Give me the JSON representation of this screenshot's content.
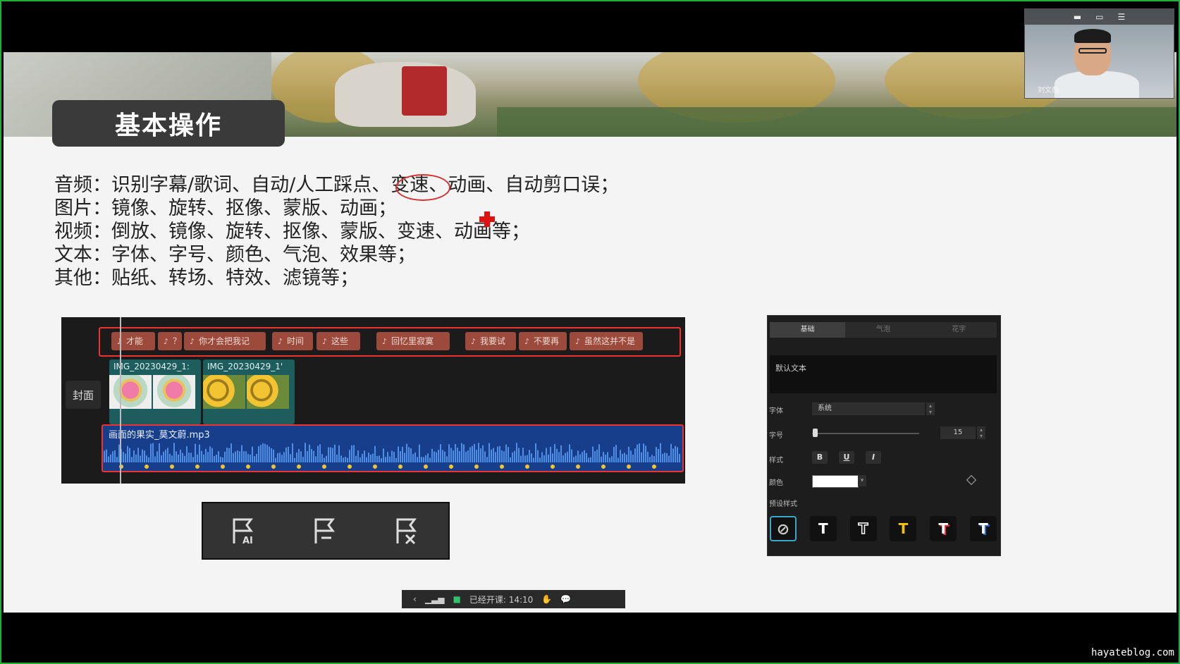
{
  "slide": {
    "title": "基本操作",
    "lines": [
      "音频：识别字幕/歌词、自动/人工踩点、变速、动画、自动剪口误；",
      "图片：镜像、旋转、抠像、蒙版、动画；",
      "视频：倒放、镜像、旋转、抠像、蒙版、变速、动画等；",
      "文本：字体、字号、颜色、气泡、效果等；",
      "其他：贴纸、转场、特效、滤镜等；"
    ]
  },
  "timeline": {
    "cover_label": "封面",
    "subtitle_clips": [
      "才能",
      "？",
      "你才会把我记",
      "时间",
      "这些",
      "回忆里寂寞",
      "我要试",
      "不要再",
      "虽然这并不是"
    ],
    "subtitle_icon": "tiktok-note-icon",
    "video_clips": [
      "IMG_20230429_1:",
      "IMG_20230429_1'"
    ],
    "audio_label": "画面的果实_莫文蔚.mp3"
  },
  "beat_toolbar": {
    "icons": [
      "auto-beat-icon",
      "manual-beat-icon",
      "clear-beat-icon"
    ]
  },
  "text_panel": {
    "tabs": [
      "基础",
      "气泡",
      "花字"
    ],
    "default_text": "默认文本",
    "font_label": "字体",
    "font_value": "系统",
    "size_label": "字号",
    "size_value": "15",
    "style_label": "样式",
    "style_buttons": [
      "B",
      "U",
      "I"
    ],
    "color_label": "颜色",
    "color_value": "#ffffff",
    "preset_label": "预设样式",
    "presets": [
      {
        "glyph": "⃠",
        "color": "#cccccc"
      },
      {
        "glyph": "T",
        "color": "#ffffff"
      },
      {
        "glyph": "T",
        "color": "#ffffff"
      },
      {
        "glyph": "T",
        "color": "#f5c211"
      },
      {
        "glyph": "T",
        "color": "#ffffff"
      },
      {
        "glyph": "T",
        "color": "#ffffff"
      }
    ]
  },
  "status_bar": {
    "text": "已经开课: 14:10"
  },
  "video_call": {
    "name": "刘文彪"
  },
  "watermark": "hayateblog.com"
}
